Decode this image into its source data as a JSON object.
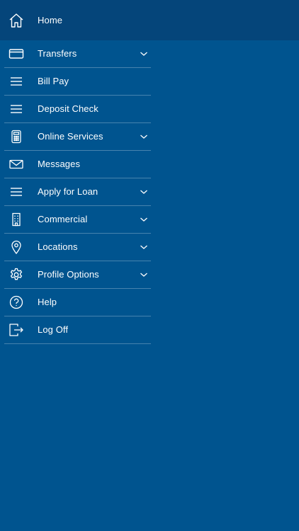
{
  "menu": {
    "items": [
      {
        "label": "Home",
        "icon": "home-icon",
        "expandable": false
      },
      {
        "label": "Transfers",
        "icon": "card-icon",
        "expandable": true
      },
      {
        "label": "Bill Pay",
        "icon": "menu-lines-icon",
        "expandable": false
      },
      {
        "label": "Deposit Check",
        "icon": "menu-lines-icon",
        "expandable": false
      },
      {
        "label": "Online Services",
        "icon": "calculator-icon",
        "expandable": true
      },
      {
        "label": "Messages",
        "icon": "envelope-icon",
        "expandable": false
      },
      {
        "label": "Apply for Loan",
        "icon": "menu-lines-icon",
        "expandable": true
      },
      {
        "label": "Commercial",
        "icon": "building-icon",
        "expandable": true
      },
      {
        "label": "Locations",
        "icon": "map-pin-icon",
        "expandable": true
      },
      {
        "label": "Profile Options",
        "icon": "gear-icon",
        "expandable": true
      },
      {
        "label": "Help",
        "icon": "help-icon",
        "expandable": false
      },
      {
        "label": "Log Off",
        "icon": "logout-icon",
        "expandable": false
      }
    ]
  },
  "colors": {
    "background": "#00548f",
    "home_highlight": "#05457a",
    "text": "#ffffff"
  }
}
